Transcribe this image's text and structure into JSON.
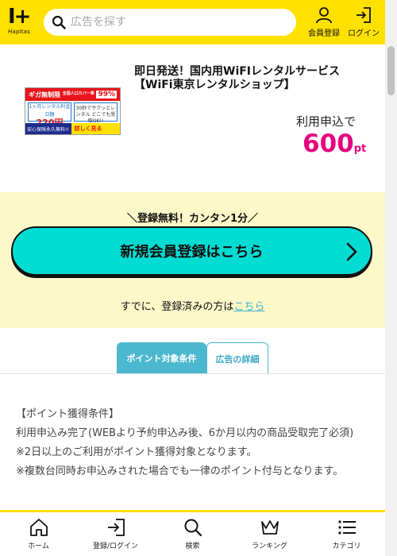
{
  "header": {
    "logo_mark": "I+",
    "logo_sub": "Hapitas",
    "search_placeholder": "広告を探す",
    "member_label": "会員登録",
    "login_label": "ログイン"
  },
  "ad": {
    "title": "即日発送！国内用WiFIレンタルサービス【WiFi東京レンタルショップ】",
    "banner": {
      "top_left": "ギガ無制限",
      "top_mid": "全国人口カバー率",
      "top_pct": "99%",
      "price_caption": "1ヶ月レンタル料金 日額",
      "price_value": "220円",
      "note": "30秒でサクッとレンタル どこでも受取OK!!",
      "bottom_left": "安心保険永久無料!!",
      "bottom_right": "詳しく見る"
    },
    "reward_label": "利用申込で",
    "reward_points": "600",
    "reward_unit": "pt"
  },
  "registration": {
    "caption": "＼登録無料！カンタン1分／",
    "button_label": "新規会員登録はこちら",
    "already_text": "すでに、登録済みの方は",
    "already_link": "こちら"
  },
  "tabs": [
    {
      "label": "ポイント対象条件",
      "active": true
    },
    {
      "label": "広告の詳細",
      "active": false
    }
  ],
  "conditions": {
    "heading": "【ポイント獲得条件】",
    "line1": "利用申込み完了(WEBより予約申込み後、6か月以内の商品受取完了必須)",
    "line2": "※2日以上のご利用がポイント獲得対象となります。",
    "line3": "※複数台同時お申込みされた場合でも一律のポイント付与となります。"
  },
  "bottom_nav": [
    {
      "label": "ホーム",
      "icon": "home-icon"
    },
    {
      "label": "登録/ログイン",
      "icon": "login-icon"
    },
    {
      "label": "検索",
      "icon": "search-icon"
    },
    {
      "label": "ランキング",
      "icon": "crown-icon"
    },
    {
      "label": "カテゴリ",
      "icon": "list-icon"
    }
  ],
  "colors": {
    "brand_yellow": "#ffe100",
    "accent_pink": "#e7007f",
    "cta_cyan": "#00dcd2",
    "tab_blue": "#4bb8cf"
  }
}
